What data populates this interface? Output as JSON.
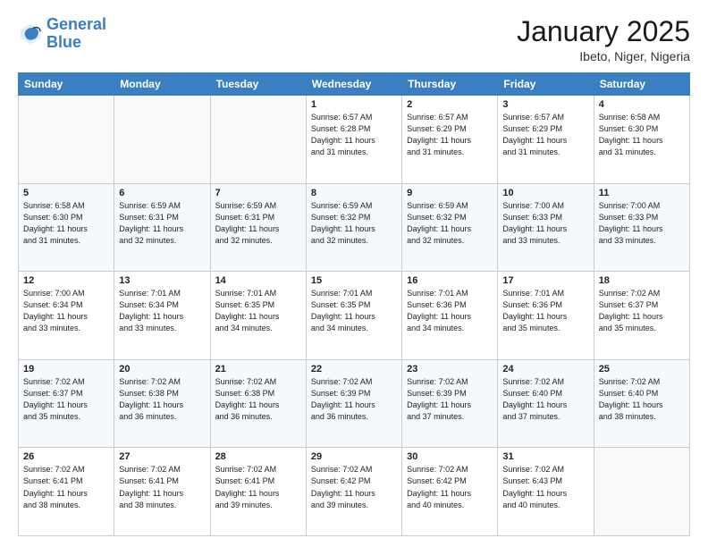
{
  "header": {
    "logo_line1": "General",
    "logo_line2": "Blue",
    "title": "January 2025",
    "subtitle": "Ibeto, Niger, Nigeria"
  },
  "weekdays": [
    "Sunday",
    "Monday",
    "Tuesday",
    "Wednesday",
    "Thursday",
    "Friday",
    "Saturday"
  ],
  "weeks": [
    [
      {
        "day": "",
        "info": ""
      },
      {
        "day": "",
        "info": ""
      },
      {
        "day": "",
        "info": ""
      },
      {
        "day": "1",
        "info": "Sunrise: 6:57 AM\nSunset: 6:28 PM\nDaylight: 11 hours\nand 31 minutes."
      },
      {
        "day": "2",
        "info": "Sunrise: 6:57 AM\nSunset: 6:29 PM\nDaylight: 11 hours\nand 31 minutes."
      },
      {
        "day": "3",
        "info": "Sunrise: 6:57 AM\nSunset: 6:29 PM\nDaylight: 11 hours\nand 31 minutes."
      },
      {
        "day": "4",
        "info": "Sunrise: 6:58 AM\nSunset: 6:30 PM\nDaylight: 11 hours\nand 31 minutes."
      }
    ],
    [
      {
        "day": "5",
        "info": "Sunrise: 6:58 AM\nSunset: 6:30 PM\nDaylight: 11 hours\nand 31 minutes."
      },
      {
        "day": "6",
        "info": "Sunrise: 6:59 AM\nSunset: 6:31 PM\nDaylight: 11 hours\nand 32 minutes."
      },
      {
        "day": "7",
        "info": "Sunrise: 6:59 AM\nSunset: 6:31 PM\nDaylight: 11 hours\nand 32 minutes."
      },
      {
        "day": "8",
        "info": "Sunrise: 6:59 AM\nSunset: 6:32 PM\nDaylight: 11 hours\nand 32 minutes."
      },
      {
        "day": "9",
        "info": "Sunrise: 6:59 AM\nSunset: 6:32 PM\nDaylight: 11 hours\nand 32 minutes."
      },
      {
        "day": "10",
        "info": "Sunrise: 7:00 AM\nSunset: 6:33 PM\nDaylight: 11 hours\nand 33 minutes."
      },
      {
        "day": "11",
        "info": "Sunrise: 7:00 AM\nSunset: 6:33 PM\nDaylight: 11 hours\nand 33 minutes."
      }
    ],
    [
      {
        "day": "12",
        "info": "Sunrise: 7:00 AM\nSunset: 6:34 PM\nDaylight: 11 hours\nand 33 minutes."
      },
      {
        "day": "13",
        "info": "Sunrise: 7:01 AM\nSunset: 6:34 PM\nDaylight: 11 hours\nand 33 minutes."
      },
      {
        "day": "14",
        "info": "Sunrise: 7:01 AM\nSunset: 6:35 PM\nDaylight: 11 hours\nand 34 minutes."
      },
      {
        "day": "15",
        "info": "Sunrise: 7:01 AM\nSunset: 6:35 PM\nDaylight: 11 hours\nand 34 minutes."
      },
      {
        "day": "16",
        "info": "Sunrise: 7:01 AM\nSunset: 6:36 PM\nDaylight: 11 hours\nand 34 minutes."
      },
      {
        "day": "17",
        "info": "Sunrise: 7:01 AM\nSunset: 6:36 PM\nDaylight: 11 hours\nand 35 minutes."
      },
      {
        "day": "18",
        "info": "Sunrise: 7:02 AM\nSunset: 6:37 PM\nDaylight: 11 hours\nand 35 minutes."
      }
    ],
    [
      {
        "day": "19",
        "info": "Sunrise: 7:02 AM\nSunset: 6:37 PM\nDaylight: 11 hours\nand 35 minutes."
      },
      {
        "day": "20",
        "info": "Sunrise: 7:02 AM\nSunset: 6:38 PM\nDaylight: 11 hours\nand 36 minutes."
      },
      {
        "day": "21",
        "info": "Sunrise: 7:02 AM\nSunset: 6:38 PM\nDaylight: 11 hours\nand 36 minutes."
      },
      {
        "day": "22",
        "info": "Sunrise: 7:02 AM\nSunset: 6:39 PM\nDaylight: 11 hours\nand 36 minutes."
      },
      {
        "day": "23",
        "info": "Sunrise: 7:02 AM\nSunset: 6:39 PM\nDaylight: 11 hours\nand 37 minutes."
      },
      {
        "day": "24",
        "info": "Sunrise: 7:02 AM\nSunset: 6:40 PM\nDaylight: 11 hours\nand 37 minutes."
      },
      {
        "day": "25",
        "info": "Sunrise: 7:02 AM\nSunset: 6:40 PM\nDaylight: 11 hours\nand 38 minutes."
      }
    ],
    [
      {
        "day": "26",
        "info": "Sunrise: 7:02 AM\nSunset: 6:41 PM\nDaylight: 11 hours\nand 38 minutes."
      },
      {
        "day": "27",
        "info": "Sunrise: 7:02 AM\nSunset: 6:41 PM\nDaylight: 11 hours\nand 38 minutes."
      },
      {
        "day": "28",
        "info": "Sunrise: 7:02 AM\nSunset: 6:41 PM\nDaylight: 11 hours\nand 39 minutes."
      },
      {
        "day": "29",
        "info": "Sunrise: 7:02 AM\nSunset: 6:42 PM\nDaylight: 11 hours\nand 39 minutes."
      },
      {
        "day": "30",
        "info": "Sunrise: 7:02 AM\nSunset: 6:42 PM\nDaylight: 11 hours\nand 40 minutes."
      },
      {
        "day": "31",
        "info": "Sunrise: 7:02 AM\nSunset: 6:43 PM\nDaylight: 11 hours\nand 40 minutes."
      },
      {
        "day": "",
        "info": ""
      }
    ]
  ]
}
